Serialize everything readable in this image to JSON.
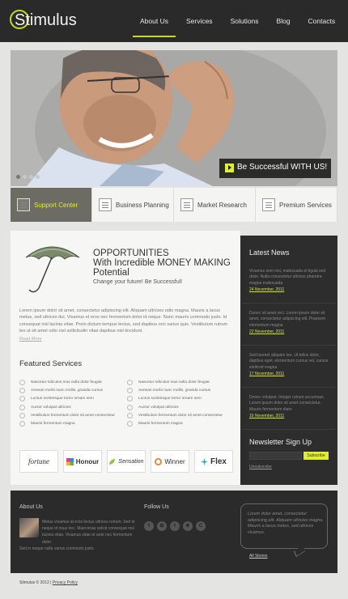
{
  "brand": {
    "name": "Stimulus",
    "accent": "#e1ee2f"
  },
  "nav": [
    "About Us",
    "Services",
    "Solutions",
    "Blog",
    "Contacts"
  ],
  "slider": {
    "caption": "Be Successful WITH US!",
    "slides": 4,
    "active": 1
  },
  "tabs": [
    "Support Center",
    "Business Planning",
    "Market Research",
    "Premium Services"
  ],
  "intro": {
    "title_line1": "OPPORTUNITIES",
    "title_line2": "With Incredible MONEY MAKING",
    "title_line3": "Potential",
    "subtitle": "Change your future! Be Successful!",
    "body": "Lorem ipsum dolor sit amet, consectetur adipiscing elit. Aliquam ultricies odio magna. Mauris a lacus metus, sed ultrices dui. Vivamus et eros nec fermentum dolor id neque. Nunc mauris commodo justo. Id consequat nisl lacinia vitae. Proin dictum tempus lectus, sed dapibus orci varius quis. Vestibulum rutrum leo ut sit amet odio nisl sollicitudin vitae dapibus nisl tincidunt.",
    "read_more": "Read More"
  },
  "featured": {
    "heading": "Featured Services",
    "col1": [
      "Nascetur ridiculus mus nulla dolor feugiat",
      "Aenean morbi nunc mollis, gravida cursus",
      "Luctus scelerisque tortor ornare sem",
      "Auctor volutpat ultricies",
      "Vestibulum fermentum dolor sit amet consectetur",
      "Mauris fermentum magna"
    ],
    "col2": [
      "Nascetur ridiculus mus nulla dolor feugiat",
      "Aenean morbi nunc mollis, gravida cursus",
      "Luctus scelerisque tortor ornare sem",
      "Auctor volutpat ultricies",
      "Vestibulum fermentum dolor sit amet consectetur",
      "Mauris fermentum magna"
    ]
  },
  "partners": [
    "fortune",
    "Honour",
    "Sensation",
    "Winner",
    "Flex"
  ],
  "news": {
    "heading": "Latest News",
    "items": [
      {
        "text": "Vivamus sem nisi, malesuada et ligula sed dolor. Nulla consectetur ultrices pharetra magna malesuada",
        "date": "24 November, 2011"
      },
      {
        "text": "Donec sit amet orci. Lorem ipsum dolor sit amet, consectetur adipiscing elit. Praesent elementum magna",
        "date": "22 November, 2011"
      },
      {
        "text": "Sed laoreet aliquam leo. Ut tellus dolor, dapibus eget, elementum cursus vel, cursus eleifend magna",
        "date": "17 November, 2011"
      },
      {
        "text": "Donec volutpat. Integer rutrum accumsan. Lorem ipsum dolor sit amet consectetur. Mauris fermentum diam",
        "date": "16 November, 2011"
      }
    ]
  },
  "newsletter": {
    "heading": "Newsletter Sign Up",
    "placeholder": "",
    "button": "Subscribe",
    "unsubscribe": "Unsubscribe"
  },
  "footer": {
    "about_heading": "About Us",
    "about_text": "Metus vivamus at eros lectus ultrices rutrum. Sed in neque id risus nec. Maecenas solicit consequat nisl lacinia vitae. Vivamus vitae et ante nec fermentum dolor.",
    "about_text2": "Sed in neque nulla varius commodo justo.",
    "follow_heading": "Follow Us",
    "social": [
      "f",
      "✿",
      "t",
      "❦",
      "C"
    ],
    "quote": "Lorem dolor amet, consectetur adipiscing elit. Aliquam ultricies magna. Mauris a lacus metus, sed ultrices vivamus.",
    "all_stories": "All Stories"
  },
  "copyright": {
    "text": "Stimulus © 2012 |",
    "privacy": "Privacy Policy"
  }
}
